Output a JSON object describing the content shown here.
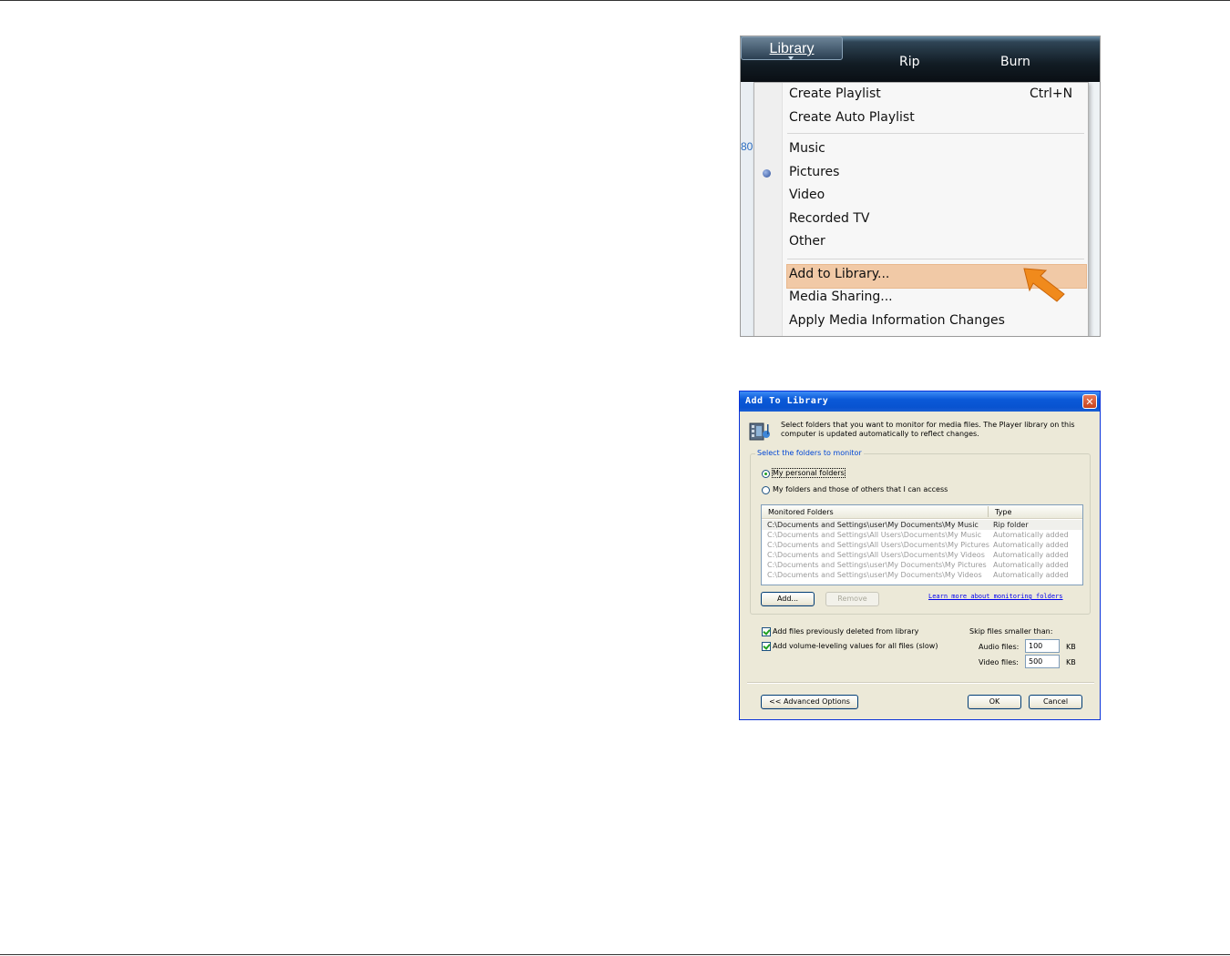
{
  "wmp": {
    "tabs": [
      "Library",
      "Rip",
      "Burn"
    ],
    "background_number": "80",
    "menu": {
      "create_playlist": "Create Playlist",
      "create_playlist_shortcut": "Ctrl+N",
      "create_auto_playlist": "Create Auto Playlist",
      "music": "Music",
      "pictures": "Pictures",
      "video": "Video",
      "recorded_tv": "Recorded TV",
      "other": "Other",
      "add_to_library": "Add to Library...",
      "media_sharing": "Media Sharing...",
      "apply_media_info": "Apply Media Information Changes",
      "selected_category": "Pictures",
      "highlighted_item": "Add to Library..."
    },
    "highlight_color": "#f1c9a6",
    "arrow_color": "#f08a1c"
  },
  "dialog": {
    "title": "Add To Library",
    "close_glyph": "✕",
    "description": "Select folders that you want to monitor for media files. The Player library on this computer is updated automatically to reflect changes.",
    "group_label": "Select the folders to monitor",
    "radio_personal": "My personal folders",
    "radio_others": "My folders and those of others that I can access",
    "selected_radio": "My personal folders",
    "list": {
      "headers": [
        "Monitored Folders",
        "Type"
      ],
      "rows": [
        {
          "path": "C:\\Documents and Settings\\user\\My Documents\\My Music",
          "type": "Rip folder"
        },
        {
          "path": "C:\\Documents and Settings\\All Users\\Documents\\My Music",
          "type": "Automatically added"
        },
        {
          "path": "C:\\Documents and Settings\\All Users\\Documents\\My Pictures",
          "type": "Automatically added"
        },
        {
          "path": "C:\\Documents and Settings\\All Users\\Documents\\My Videos",
          "type": "Automatically added"
        },
        {
          "path": "C:\\Documents and Settings\\user\\My Documents\\My Pictures",
          "type": "Automatically added"
        },
        {
          "path": "C:\\Documents and Settings\\user\\My Documents\\My Videos",
          "type": "Automatically added"
        }
      ]
    },
    "add_button": "Add...",
    "remove_button": "Remove",
    "learn_link": "Learn more about monitoring folders",
    "chk_deleted": "Add files previously deleted from library",
    "chk_volume": "Add volume-leveling values for all files (slow)",
    "chk_deleted_checked": true,
    "chk_volume_checked": true,
    "skip_label": "Skip files smaller than:",
    "audio_label": "Audio files:",
    "audio_value": "100",
    "video_label": "Video files:",
    "video_value": "500",
    "unit": "KB",
    "advanced_button": "<< Advanced Options",
    "ok_button": "OK",
    "cancel_button": "Cancel",
    "titlebar_color": "#0a59d8",
    "link_color": "#0000ee"
  }
}
